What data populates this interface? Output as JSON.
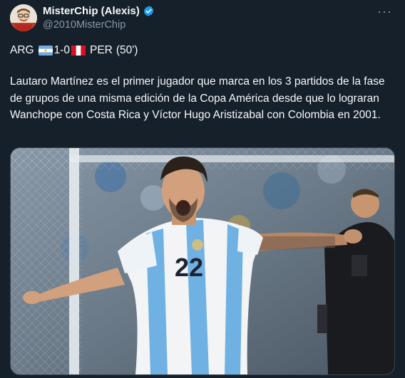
{
  "author": {
    "display_name": "MisterChip (Alexis)",
    "handle": "@2010MisterChip",
    "verified_color": "#1d9bf0"
  },
  "tweet": {
    "score": {
      "team_home": "ARG",
      "score": "1-0",
      "team_away": "PER",
      "minute": "(50')"
    },
    "text": "Lautaro Martínez es el primer jugador que marca en los 3 partidos de la fase de grupos de una misma edición de la Copa América desde que lo lograran Wanchope con Costa Rica y Víctor Hugo Aristizabal con Colombia en 2001."
  },
  "media": {
    "jersey_number": "22",
    "icon": "photo-lautaro-celebrating"
  },
  "ui": {
    "more_icon": "more-options-icon",
    "more_glyph": "···"
  },
  "colors": {
    "background": "#15202b",
    "text": "#f7f9f9",
    "secondary": "#8b98a5",
    "accent": "#1d9bf0"
  }
}
